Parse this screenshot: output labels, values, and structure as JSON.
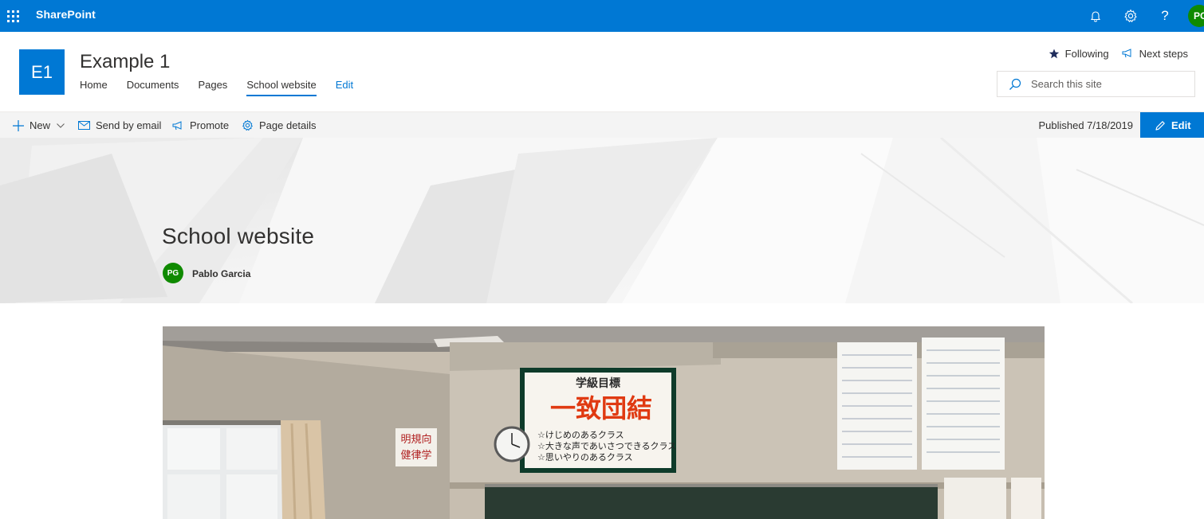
{
  "suite_bar": {
    "brand": "SharePoint",
    "avatar_initials": "PG",
    "icons": [
      "waffle-icon",
      "bell-icon",
      "gear-icon",
      "help-icon"
    ],
    "help_glyph": "?"
  },
  "site": {
    "logo_text": "E1",
    "title": "Example 1",
    "nav": [
      {
        "label": "Home"
      },
      {
        "label": "Documents"
      },
      {
        "label": "Pages"
      },
      {
        "label": "School website"
      },
      {
        "label": "Edit"
      }
    ],
    "following_label": "Following",
    "next_steps_label": "Next steps",
    "search_placeholder": "Search this site"
  },
  "command_bar": {
    "new_label": "New",
    "send_email_label": "Send by email",
    "promote_label": "Promote",
    "page_details_label": "Page details",
    "published": "Published 7/18/2019",
    "edit_label": "Edit"
  },
  "page": {
    "title": "School website",
    "author_initials": "PG",
    "author_name": "Pablo Garcia"
  },
  "photo": {
    "goal_header": "学級目標",
    "goal_main": "一致団結",
    "goal_lines": [
      "☆けじめのあるクラス",
      "☆大きな声であいさつできるクラス",
      "☆思いやりのあるクラス"
    ],
    "side_sign_lines": [
      "明規向",
      "健律学"
    ]
  },
  "colors": {
    "brand_blue": "#0078d4",
    "avatar_green": "#0f8a00",
    "command_bar_bg": "#f4f4f4"
  }
}
